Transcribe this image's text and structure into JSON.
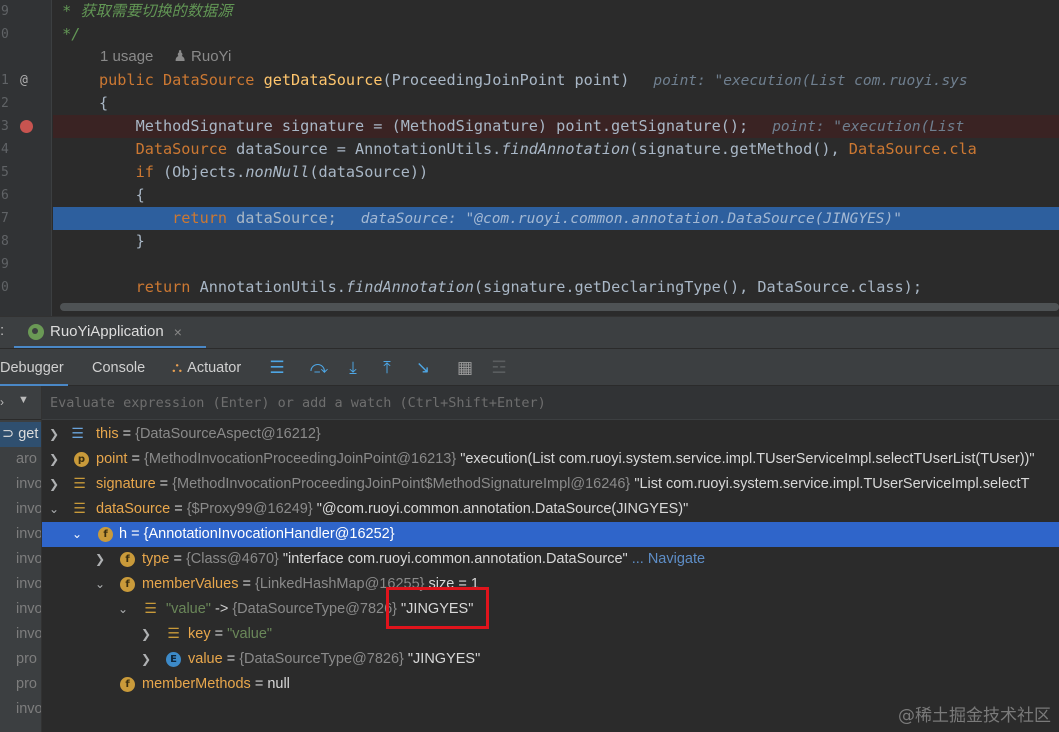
{
  "editor": {
    "line_numbers": [
      "9",
      "0",
      "",
      "1",
      "2",
      "3",
      "4",
      "5",
      "6",
      "7",
      "8",
      "9",
      "0"
    ],
    "comment_line1": " * 获取需要切换的数据源",
    "comment_line2": " */",
    "usage_count": "1 usage",
    "usage_author": "RuoYi",
    "sig_public": "public ",
    "sig_type": "DataSource ",
    "sig_method": "getDataSource",
    "sig_params": "(ProceedingJoinPoint point)",
    "sig_hint": "point: \"execution(List com.ruoyi.sys",
    "brace_open": "{",
    "line3_code": "    MethodSignature signature = (MethodSignature) point.getSignature();",
    "line3_hint": "point: \"execution(List",
    "line4_type": "    DataSource ",
    "line4_a": "dataSource = AnnotationUtils.",
    "line4_m": "findAnnotation",
    "line4_b": "(signature.getMethod(), ",
    "line4_c": "DataSource.cla",
    "line5_kw": "    if ",
    "line5_a": "(Objects.",
    "line5_m": "nonNull",
    "line5_b": "(dataSource))",
    "line6": "    {",
    "line7_kw": "        return ",
    "line7_a": "dataSource;",
    "line7_hint": "dataSource: \"@com.ruoyi.common.annotation.DataSource(JINGYES)\"",
    "line8": "    }",
    "line10_kw": "    return ",
    "line10_a": "AnnotationUtils.",
    "line10_m": "findAnnotation",
    "line10_b": "(signature.getDeclaringType(), DataSource.class);"
  },
  "run_tab": {
    "prefix": ":",
    "label": "RuoYiApplication",
    "close": "×"
  },
  "debugger_tabs": {
    "debugger": "Debugger",
    "console": "Console",
    "actuator": "Actuator"
  },
  "icons": {
    "menu": "hamburger-icon",
    "step_over": "step-over-icon",
    "step_into": "step-into-icon",
    "step_out": "step-out-icon",
    "run_to_cursor": "run-to-cursor-icon",
    "evaluate": "evaluate-table-icon",
    "trace": "trace-icon"
  },
  "evaluate": {
    "placeholder": "Evaluate expression (Enter) or add a watch (Ctrl+Shift+Enter)"
  },
  "frames": {
    "items": [
      "get",
      "aro",
      "invo",
      "invo",
      "invo",
      "invo",
      "invo",
      "invo",
      "invo",
      "pro",
      "pro",
      "invo"
    ]
  },
  "variables": [
    {
      "name": "this",
      "type": "{DataSourceAspect@16212}",
      "value": ""
    },
    {
      "name": "point",
      "type": "{MethodInvocationProceedingJoinPoint@16213}",
      "value": "\"execution(List com.ruoyi.system.service.impl.TUserServiceImpl.selectTUserList(TUser))\""
    },
    {
      "name": "signature",
      "type": "{MethodInvocationProceedingJoinPoint$MethodSignatureImpl@16246}",
      "value": "\"List com.ruoyi.system.service.impl.TUserServiceImpl.selectT"
    },
    {
      "name": "dataSource",
      "type": "{$Proxy99@16249}",
      "value": "\"@com.ruoyi.common.annotation.DataSource(JINGYES)\""
    },
    {
      "name": "h",
      "type": "{AnnotationInvocationHandler@16252}",
      "value": ""
    },
    {
      "name": "type",
      "type": "{Class@4670}",
      "value": "\"interface com.ruoyi.common.annotation.DataSource\"",
      "nav": "... Navigate"
    },
    {
      "name": "memberValues",
      "type": "{LinkedHashMap@16255}",
      "value": "size = 1"
    },
    {
      "name": "\"value\"",
      "arrow": "->",
      "type": "{DataSourceType@7826}",
      "value": "\"JINGYES\""
    },
    {
      "name": "key",
      "type": "",
      "value": "\"value\""
    },
    {
      "name": "value",
      "type": "{DataSourceType@7826}",
      "value": "\"JINGYES\""
    },
    {
      "name": "memberMethods",
      "type": "",
      "value": "null"
    }
  ],
  "watermark": "@稀土掘金技术社区"
}
